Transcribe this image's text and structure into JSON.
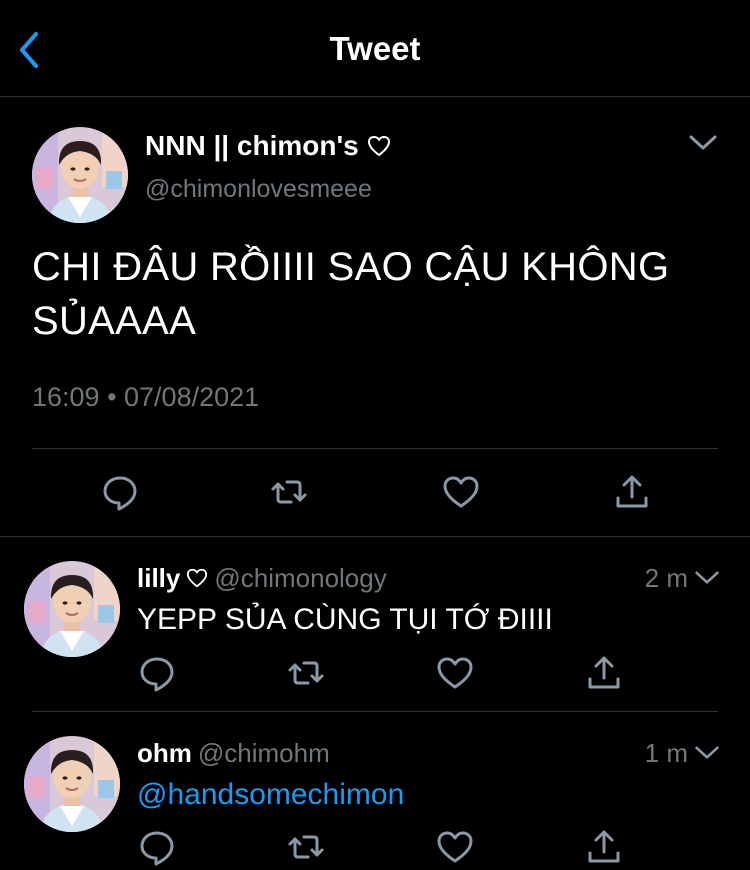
{
  "header": {
    "title": "Tweet"
  },
  "tweet": {
    "name": "NNN || chimon's",
    "handle": "@chimonlovesmeee",
    "text": "CHI ĐÂU RỒIIII SAO CẬU KHÔNG SỦAAAA",
    "timestamp": "16:09 • 07/08/2021"
  },
  "replies": [
    {
      "name": "lilly",
      "handle": "@chimonology",
      "time": "2 m",
      "text": "YEPP SỦA CÙNG TỤI TỚ ĐIIII"
    },
    {
      "name": "ohm",
      "handle": "@chimohm",
      "time": "1 m",
      "text": "@handsomechimon"
    }
  ],
  "icons": {
    "back": "chevron-left-icon",
    "more": "chevron-down-icon",
    "reply": "reply-icon",
    "retweet": "retweet-icon",
    "like": "heart-icon",
    "share": "share-icon"
  },
  "colors": {
    "background": "#000000",
    "text": "#ffffff",
    "muted": "#71767b",
    "accent": "#1d9bf0",
    "divider": "#2f3336"
  }
}
